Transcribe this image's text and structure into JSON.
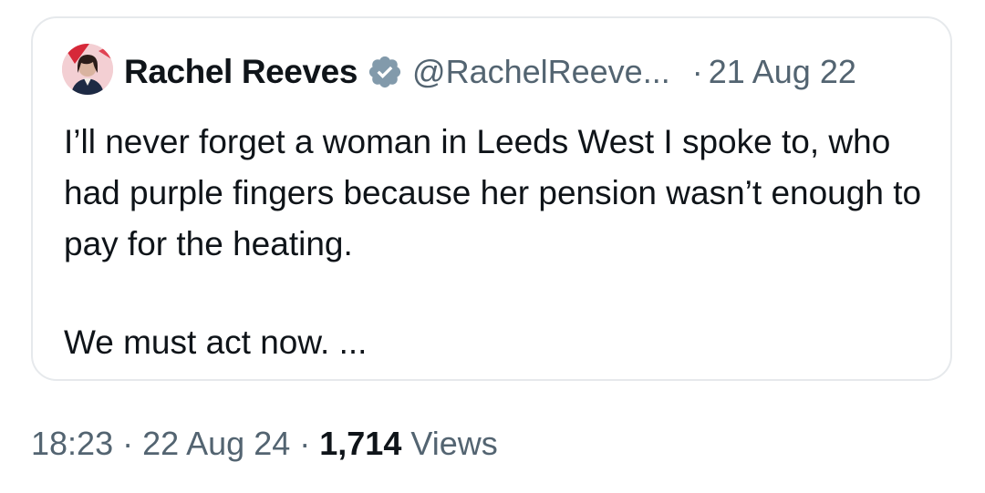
{
  "quoted_tweet": {
    "author_name": "Rachel Reeves",
    "author_handle": "@RachelReeve...",
    "separator": "·",
    "date": "21 Aug 22",
    "verified": true,
    "text_paragraphs": [
      "I’ll never forget a woman in Leeds West I spoke to, who had purple fingers because her pension wasn’t enough to pay for the heating.",
      "We must act now. ..."
    ]
  },
  "meta": {
    "time": "18:23",
    "separator": "·",
    "date": "22 Aug 24",
    "views_count": "1,714",
    "views_label": "Views"
  },
  "colors": {
    "text_primary": "#0f1419",
    "text_secondary": "#536471",
    "border": "#e6e9ec",
    "verified_badge": "#829aab"
  },
  "icons": {
    "verified": "verified-badge-icon",
    "avatar": "user-avatar"
  }
}
